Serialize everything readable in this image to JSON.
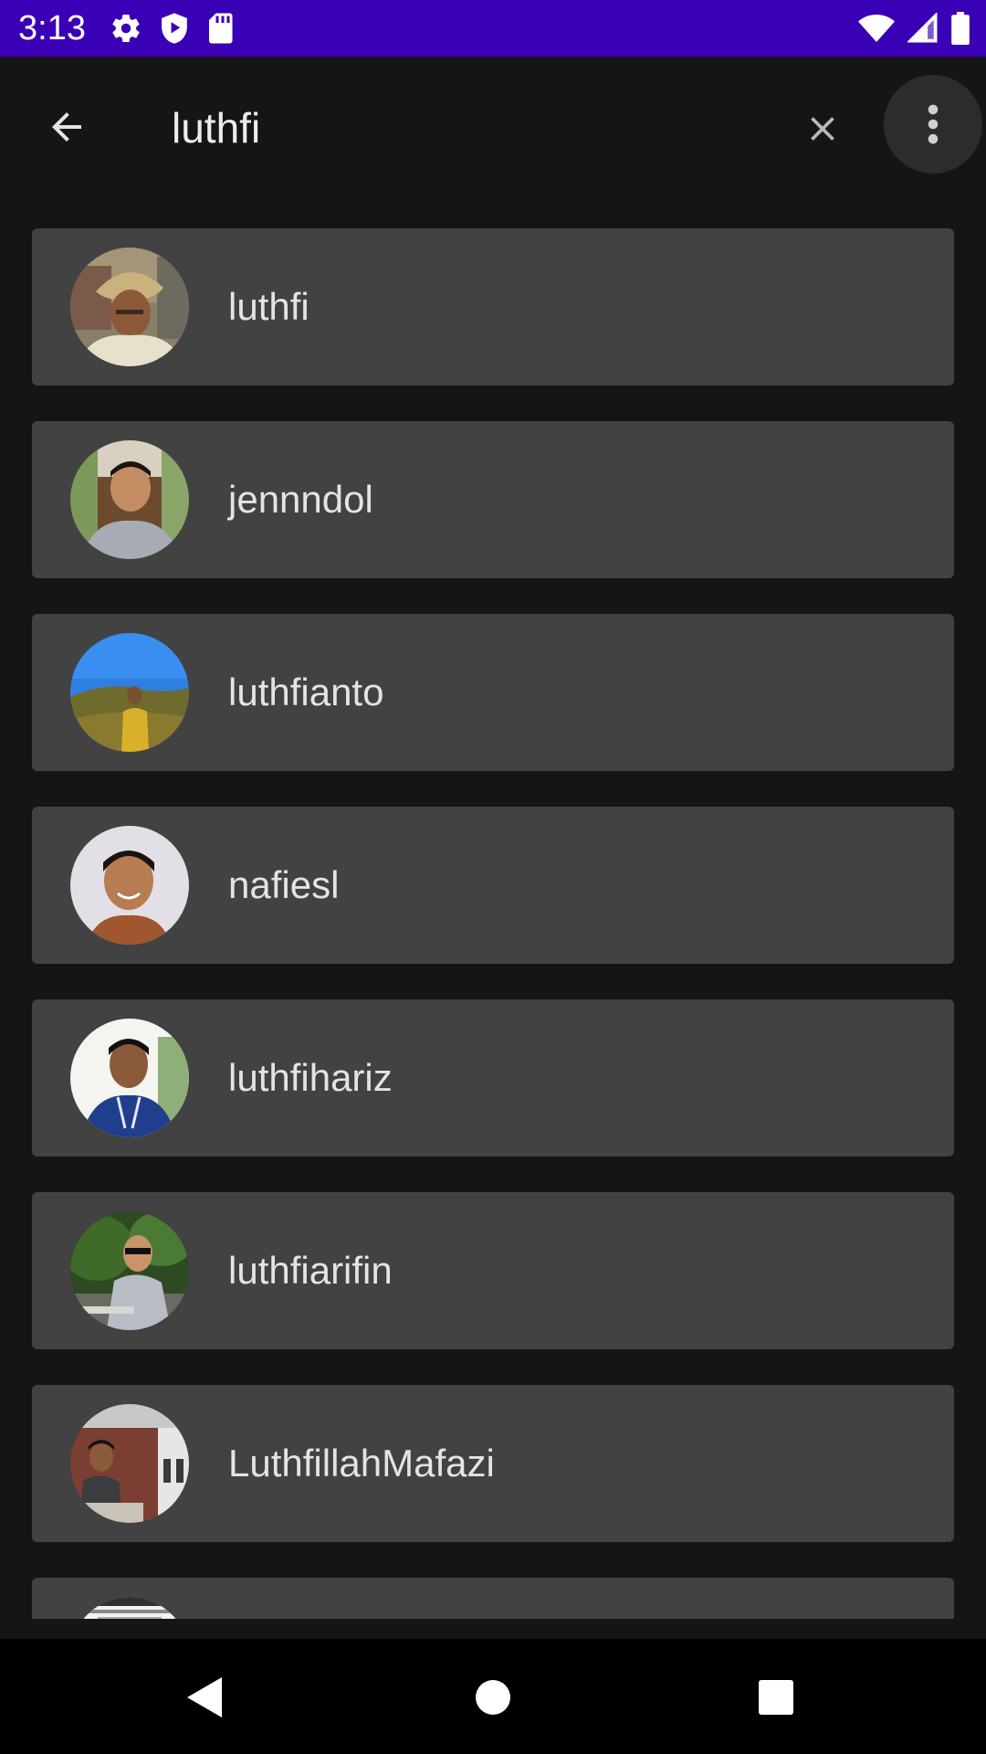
{
  "status_bar": {
    "time": "3:13",
    "background": "#3a00b6",
    "left_icons": [
      "gear-icon",
      "play-protect-icon",
      "sd-card-icon"
    ],
    "right_icons": [
      "wifi-icon",
      "signal-icon",
      "battery-icon"
    ]
  },
  "toolbar": {
    "search_value": "luthfi",
    "back_icon": "arrow-left-icon",
    "clear_icon": "close-icon",
    "more_icon": "more-vertical-icon"
  },
  "results": [
    {
      "username": "luthfi",
      "avatar": "avatar-painting"
    },
    {
      "username": "jennndol",
      "avatar": "avatar-man-grey-shirt"
    },
    {
      "username": "luthfianto",
      "avatar": "avatar-man-blue-sky"
    },
    {
      "username": "nafiesl",
      "avatar": "avatar-man-smiling"
    },
    {
      "username": "luthfihariz",
      "avatar": "avatar-man-lanyard"
    },
    {
      "username": "luthfiarifin",
      "avatar": "avatar-man-sunglasses"
    },
    {
      "username": "LuthfillahMafazi",
      "avatar": "avatar-man-building"
    },
    {
      "username": "",
      "avatar": "avatar-partial"
    }
  ],
  "colors": {
    "background": "#151515",
    "card": "#424242",
    "text": "#e4e4e4",
    "accent": "#3a00b6"
  },
  "nav_bar": {
    "icons": [
      "back-triangle-icon",
      "home-circle-icon",
      "recents-square-icon"
    ]
  }
}
